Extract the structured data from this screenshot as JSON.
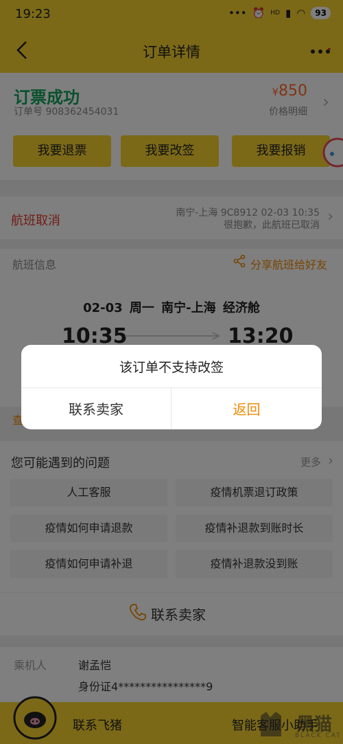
{
  "status_bar": {
    "time": "19:23",
    "network": "HD",
    "battery": "93"
  },
  "nav": {
    "title": "订单详情"
  },
  "order": {
    "status": "订票成功",
    "order_number": "订单号 908362454031",
    "currency": "¥",
    "price": "850",
    "price_detail": "价格明细"
  },
  "actions": {
    "refund": "我要退票",
    "change": "我要改签",
    "reimburse": "我要报销"
  },
  "cancel": {
    "title": "航班取消",
    "route": "南宁-上海 9C8912 02-03 10:35",
    "note": "很抱歉，此航班已取消"
  },
  "flight": {
    "label": "航班信息",
    "share": "分享航班给好友",
    "summary": "02-03 周一 南宁-上海 经济舱",
    "dep_time": "10:35",
    "arr_time": "13:20",
    "link_stub": "查"
  },
  "faq": {
    "title": "您可能遇到的问题",
    "more": "更多",
    "items": [
      "人工客服",
      "疫情机票退订政策",
      "疫情如何申请退款",
      "疫情补退款到账时长",
      "疫情如何申请补退",
      "疫情补退款没到账"
    ]
  },
  "contact": {
    "label": "联系卖家"
  },
  "passenger": {
    "label": "乘机人",
    "name": "谢孟恺",
    "id": "身份证4****************9"
  },
  "bottom": {
    "contact": "联系飞猪",
    "assistant": "智能客服小助手"
  },
  "watermark": {
    "text": "黑猫",
    "sub": "BLACK CAT"
  },
  "dialog": {
    "message": "该订单不支持改签",
    "left": "联系卖家",
    "right": "返回"
  },
  "colors": {
    "brand_yellow": "#f6d331",
    "success_green": "#14a35d",
    "price_orange": "#ff6a2a",
    "alert_red": "#e03a2b",
    "link_orange": "#f08a00"
  }
}
